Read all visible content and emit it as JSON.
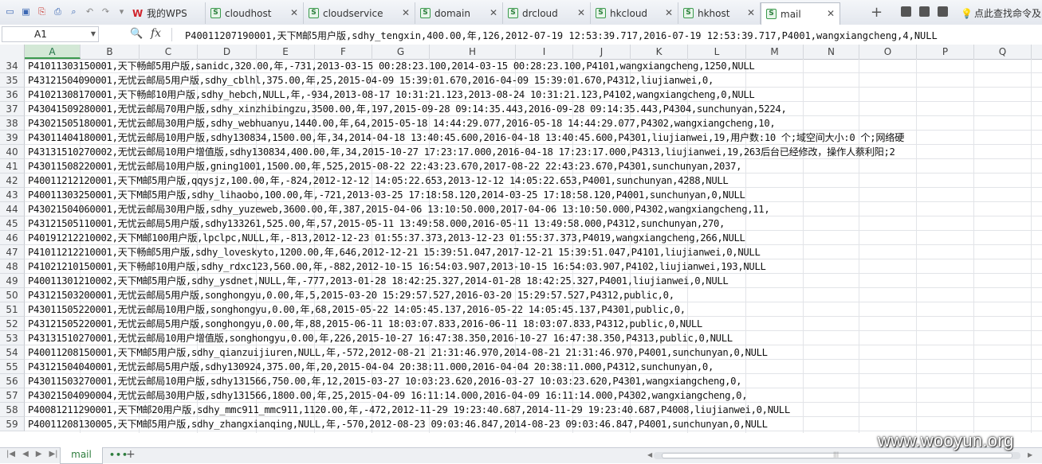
{
  "tabs": [
    {
      "label": "我的WPS",
      "type": "wps",
      "closable": false
    },
    {
      "label": "cloudhost",
      "type": "sheet",
      "closable": true
    },
    {
      "label": "cloudservice",
      "type": "sheet",
      "closable": true
    },
    {
      "label": "domain",
      "type": "sheet",
      "closable": true
    },
    {
      "label": "drcloud",
      "type": "sheet",
      "closable": true
    },
    {
      "label": "hkcloud",
      "type": "sheet",
      "closable": true
    },
    {
      "label": "hkhost",
      "type": "sheet",
      "closable": true
    },
    {
      "label": "mail",
      "type": "sheet",
      "closable": true,
      "active": true
    }
  ],
  "toolbar": {
    "find_command": "点此查找命令及",
    "icons": [
      "new-icon",
      "save-icon",
      "pdf-icon",
      "print-icon",
      "print-preview-icon",
      "undo-icon",
      "redo-icon",
      "more-icon"
    ]
  },
  "formula_bar": {
    "name_box": "A1",
    "fx": "fx",
    "content": "P40011207190001,天下M邮5用户版,sdhy_tengxin,400.00,年,126,2012-07-19 12:53:39.717,2016-07-19 12:53:39.717,P4001,wangxiangcheng,4,NULL"
  },
  "columns": [
    "A",
    "B",
    "C",
    "D",
    "E",
    "F",
    "G",
    "H",
    "I",
    "J",
    "K",
    "L",
    "M",
    "N",
    "O",
    "P",
    "Q",
    "R"
  ],
  "selected_column": "A",
  "rows": [
    {
      "n": "34",
      "text": "P41011303150001,天下畅邮5用户版,sanidc,320.00,年,-731,2013-03-15 00:28:23.100,2014-03-15 00:28:23.100,P4101,wangxiangcheng,1250,NULL"
    },
    {
      "n": "35",
      "text": "P43121504090001,无忧云邮局5用户版,sdhy_cblhl,375.00,年,25,2015-04-09 15:39:01.670,2016-04-09 15:39:01.670,P4312,liujianwei,0,"
    },
    {
      "n": "36",
      "text": "P41021308170001,天下畅邮10用户版,sdhy_hebch,NULL,年,-934,2013-08-17 10:31:21.123,2013-08-24 10:31:21.123,P4102,wangxiangcheng,0,NULL"
    },
    {
      "n": "37",
      "text": "P43041509280001,无忧云邮局70用户版,sdhy_xinzhibingzu,3500.00,年,197,2015-09-28 09:14:35.443,2016-09-28 09:14:35.443,P4304,sunchunyan,5224,"
    },
    {
      "n": "38",
      "text": "P43021505180001,无忧云邮局30用户版,sdhy_webhuanyu,1440.00,年,64,2015-05-18 14:44:29.077,2016-05-18 14:44:29.077,P4302,wangxiangcheng,10,"
    },
    {
      "n": "39",
      "text": "P43011404180001,无忧云邮局10用户版,sdhy130834,1500.00,年,34,2014-04-18 13:40:45.600,2016-04-18 13:40:45.600,P4301,liujianwei,19,用户数:10 个;域空间大小:0 个;网络硬"
    },
    {
      "n": "40",
      "text": "P43131510270002,无忧云邮局10用户增值版,sdhy130834,400.00,年,34,2015-10-27 17:23:17.000,2016-04-18 17:23:17.000,P4313,liujianwei,19,263后台已经修改，操作人蔡利阳;2"
    },
    {
      "n": "41",
      "text": "P43011508220001,无忧云邮局10用户版,gning1001,1500.00,年,525,2015-08-22 22:43:23.670,2017-08-22 22:43:23.670,P4301,sunchunyan,2037,"
    },
    {
      "n": "42",
      "text": "P40011212120001,天下M邮5用户版,qqysjz,100.00,年,-824,2012-12-12 14:05:22.653,2013-12-12 14:05:22.653,P4001,sunchunyan,4288,NULL"
    },
    {
      "n": "43",
      "text": "P40011303250001,天下M邮5用户版,sdhy_lihaobo,100.00,年,-721,2013-03-25 17:18:58.120,2014-03-25 17:18:58.120,P4001,sunchunyan,0,NULL"
    },
    {
      "n": "44",
      "text": "P43021504060001,无忧云邮局30用户版,sdhy_yuzeweb,3600.00,年,387,2015-04-06 13:10:50.000,2017-04-06 13:10:50.000,P4302,wangxiangcheng,11,"
    },
    {
      "n": "45",
      "text": "P43121505110001,无忧云邮局5用户版,sdhy133261,525.00,年,57,2015-05-11 13:49:58.000,2016-05-11 13:49:58.000,P4312,sunchunyan,270,"
    },
    {
      "n": "46",
      "text": "P40191212210002,天下M邮100用户版,lpclpc,NULL,年,-813,2012-12-23 01:55:37.373,2013-12-23 01:55:37.373,P4019,wangxiangcheng,266,NULL"
    },
    {
      "n": "47",
      "text": "P41011212210001,天下畅邮5用户版,sdhy_loveskyto,1200.00,年,646,2012-12-21 15:39:51.047,2017-12-21 15:39:51.047,P4101,liujianwei,0,NULL"
    },
    {
      "n": "48",
      "text": "P41021210150001,天下畅邮10用户版,sdhy_rdxc123,560.00,年,-882,2012-10-15 16:54:03.907,2013-10-15 16:54:03.907,P4102,liujianwei,193,NULL"
    },
    {
      "n": "49",
      "text": "P40011301210002,天下M邮5用户版,sdhy_ysdnet,NULL,年,-777,2013-01-28 18:42:25.327,2014-01-28 18:42:25.327,P4001,liujianwei,0,NULL"
    },
    {
      "n": "50",
      "text": "P43121503200001,无忧云邮局5用户版,songhongyu,0.00,年,5,2015-03-20 15:29:57.527,2016-03-20 15:29:57.527,P4312,public,0,"
    },
    {
      "n": "51",
      "text": "P43011505220001,无忧云邮局10用户版,songhongyu,0.00,年,68,2015-05-22 14:05:45.137,2016-05-22 14:05:45.137,P4301,public,0,"
    },
    {
      "n": "52",
      "text": "P43121505220001,无忧云邮局5用户版,songhongyu,0.00,年,88,2015-06-11 18:03:07.833,2016-06-11 18:03:07.833,P4312,public,0,NULL"
    },
    {
      "n": "53",
      "text": "P43131510270001,无忧云邮局10用户增值版,songhongyu,0.00,年,226,2015-10-27 16:47:38.350,2016-10-27 16:47:38.350,P4313,public,0,NULL"
    },
    {
      "n": "54",
      "text": "P40011208150001,天下M邮5用户版,sdhy_qianzuijiuren,NULL,年,-572,2012-08-21 21:31:46.970,2014-08-21 21:31:46.970,P4001,sunchunyan,0,NULL"
    },
    {
      "n": "55",
      "text": "P43121504040001,无忧云邮局5用户版,sdhy130924,375.00,年,20,2015-04-04 20:38:11.000,2016-04-04 20:38:11.000,P4312,sunchunyan,0,"
    },
    {
      "n": "56",
      "text": "P43011503270001,无忧云邮局10用户版,sdhy131566,750.00,年,12,2015-03-27 10:03:23.620,2016-03-27 10:03:23.620,P4301,wangxiangcheng,0,"
    },
    {
      "n": "57",
      "text": "P43021504090004,无忧云邮局30用户版,sdhy131566,1800.00,年,25,2015-04-09 16:11:14.000,2016-04-09 16:11:14.000,P4302,wangxiangcheng,0,"
    },
    {
      "n": "58",
      "text": "P40081211290001,天下M邮20用户版,sdhy_mmc911_mmc911,1120.00,年,-472,2012-11-29 19:23:40.687,2014-11-29 19:23:40.687,P4008,liujianwei,0,NULL"
    },
    {
      "n": "59",
      "text": "P40011208130005,天下M邮5用户版,sdhy_zhangxianqing,NULL,年,-570,2012-08-23 09:03:46.847,2014-08-23 09:03:46.847,P4001,sunchunyan,0,NULL"
    }
  ],
  "sheet_tabs": [
    {
      "label": "mail",
      "active": true
    }
  ],
  "watermark": "www.wooyun.org"
}
